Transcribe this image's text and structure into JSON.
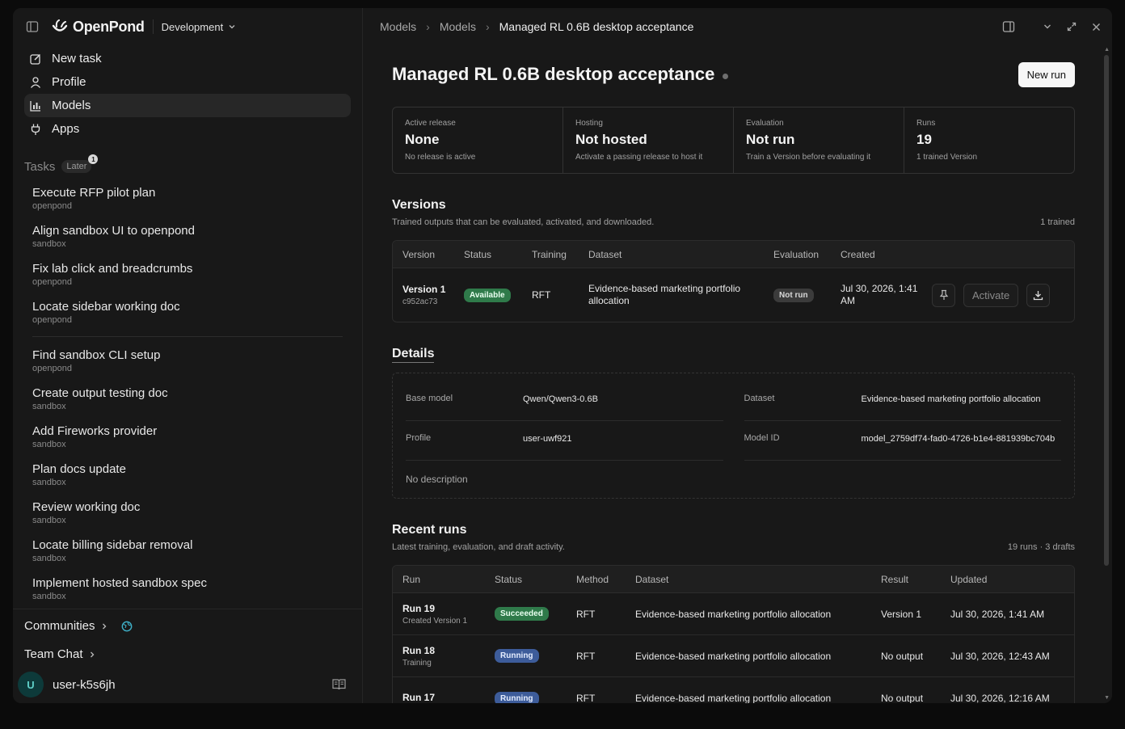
{
  "sidebar": {
    "brand": "OpenPond",
    "org": "Development",
    "nav": [
      {
        "label": "New task",
        "icon": "edit-icon"
      },
      {
        "label": "Profile",
        "icon": "user-icon"
      },
      {
        "label": "Models",
        "icon": "chart-icon"
      },
      {
        "label": "Apps",
        "icon": "plug-icon"
      }
    ],
    "tasks_title": "Tasks",
    "later_label": "Later",
    "later_count": "1",
    "tasks": [
      {
        "title": "Execute RFP pilot plan",
        "sub": "openpond"
      },
      {
        "title": "Align sandbox UI to openpond",
        "sub": "sandbox"
      },
      {
        "title": "Fix lab click and breadcrumbs",
        "sub": "openpond"
      },
      {
        "title": "Locate sidebar working doc",
        "sub": "openpond"
      },
      {
        "title": "Find sandbox CLI setup",
        "sub": "openpond"
      },
      {
        "title": "Create output testing doc",
        "sub": "sandbox"
      },
      {
        "title": "Add Fireworks provider",
        "sub": "sandbox"
      },
      {
        "title": "Plan docs update",
        "sub": "sandbox"
      },
      {
        "title": "Review working doc",
        "sub": "sandbox"
      },
      {
        "title": "Locate billing sidebar removal",
        "sub": "sandbox"
      },
      {
        "title": "Implement hosted sandbox spec",
        "sub": "sandbox"
      }
    ],
    "communities": "Communities",
    "team_chat": "Team Chat",
    "user": {
      "initial": "U",
      "name": "user-k5s6jh"
    }
  },
  "breadcrumb": [
    "Models",
    "Models",
    "Managed RL 0.6B desktop acceptance"
  ],
  "page": {
    "title": "Managed RL 0.6B desktop acceptance",
    "new_run": "New run"
  },
  "stats": [
    {
      "label": "Active release",
      "value": "None",
      "note": "No release is active"
    },
    {
      "label": "Hosting",
      "value": "Not hosted",
      "note": "Activate a passing release to host it"
    },
    {
      "label": "Evaluation",
      "value": "Not run",
      "note": "Train a Version before evaluating it"
    },
    {
      "label": "Runs",
      "value": "19",
      "note": "1 trained Version"
    }
  ],
  "versions": {
    "title": "Versions",
    "subtitle": "Trained outputs that can be evaluated, activated, and downloaded.",
    "meta": "1 trained",
    "headers": [
      "Version",
      "Status",
      "Training",
      "Dataset",
      "Evaluation",
      "Created"
    ],
    "rows": [
      {
        "version": "Version 1",
        "hash": "c952ac73",
        "status": "Available",
        "training": "RFT",
        "dataset": "Evidence-based marketing portfolio allocation",
        "evaluation": "Not run",
        "created": "Jul 30, 2026, 1:41 AM",
        "activate": "Activate"
      }
    ]
  },
  "details": {
    "title": "Details",
    "base_model_label": "Base model",
    "base_model": "Qwen/Qwen3-0.6B",
    "dataset_label": "Dataset",
    "dataset": "Evidence-based marketing portfolio allocation",
    "profile_label": "Profile",
    "profile": "user-uwf921",
    "model_id_label": "Model ID",
    "model_id": "model_2759df74-fad0-4726-b1e4-881939bc704b",
    "description": "No description"
  },
  "runs": {
    "title": "Recent runs",
    "subtitle": "Latest training, evaluation, and draft activity.",
    "meta": "19 runs · 3 drafts",
    "headers": [
      "Run",
      "Status",
      "Method",
      "Dataset",
      "Result",
      "Updated"
    ],
    "rows": [
      {
        "run": "Run 19",
        "sub": "Created Version 1",
        "status": "Succeeded",
        "method": "RFT",
        "dataset": "Evidence-based marketing portfolio allocation",
        "result": "Version 1",
        "updated": "Jul 30, 2026, 1:41 AM"
      },
      {
        "run": "Run 18",
        "sub": "Training",
        "status": "Running",
        "method": "RFT",
        "dataset": "Evidence-based marketing portfolio allocation",
        "result": "No output",
        "updated": "Jul 30, 2026, 12:43 AM"
      },
      {
        "run": "Run 17",
        "sub": "",
        "status": "Running",
        "method": "RFT",
        "dataset": "Evidence-based marketing portfolio allocation",
        "result": "No output",
        "updated": "Jul 30, 2026, 12:16 AM"
      }
    ]
  },
  "colors": {
    "accent_green": "#2f7a4a",
    "accent_blue": "#3d5c9a",
    "avatar_bg": "#0d3a3a",
    "globe": "#3fb0c8"
  }
}
